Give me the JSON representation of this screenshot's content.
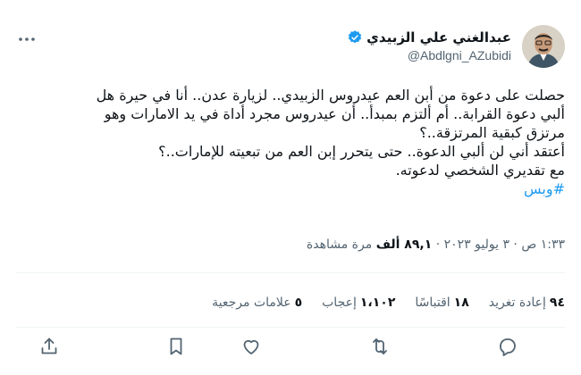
{
  "author": {
    "name": "عبدالغني علي الزبيدي",
    "handle": "@Abdlgni_AZubidi"
  },
  "tweet": {
    "lines": [
      "حصلت على دعوة من أبن العم عيدروس الزبيدي.. لزيارة عدن.. أنا في حيرة هل",
      "ألبي دعوة القرابة.. أم ألتزم بمبدأ.. أن عيدروس مجرد أداة في يد الامارات وهو",
      "مرتزق كبقية المرتزقة..؟",
      "أعتقد أني لن ألبي الدعوة.. حتى يتحرر إبن العم من تبعيته للإمارات..؟",
      "مع تقديري الشخصي لدعوته."
    ],
    "hashtag": "#وبس"
  },
  "meta": {
    "time_date": "١:٣٣ ص · ٣ يوليو ٢٠٢٣ · ",
    "views_count": "٨٩,١ ألف",
    "views_label": " مرة مشاهدة"
  },
  "stats": {
    "retweets_count": "٩٤",
    "retweets_label": "إعادة تغريد",
    "quotes_count": "١٨",
    "quotes_label": "اقتباسًا",
    "likes_count": "١،١٠٢",
    "likes_label": "إعجاب",
    "bookmarks_count": "٥",
    "bookmarks_label": "علامات مرجعية"
  },
  "icons": {
    "verified": "verified-badge-icon",
    "more": "more-icon",
    "reply": "reply-icon",
    "retweet": "retweet-icon",
    "like": "like-icon",
    "bookmark": "bookmark-icon",
    "share": "share-icon"
  },
  "colors": {
    "accent": "#1d9bf0",
    "muted": "#536471",
    "text": "#0f1419"
  }
}
